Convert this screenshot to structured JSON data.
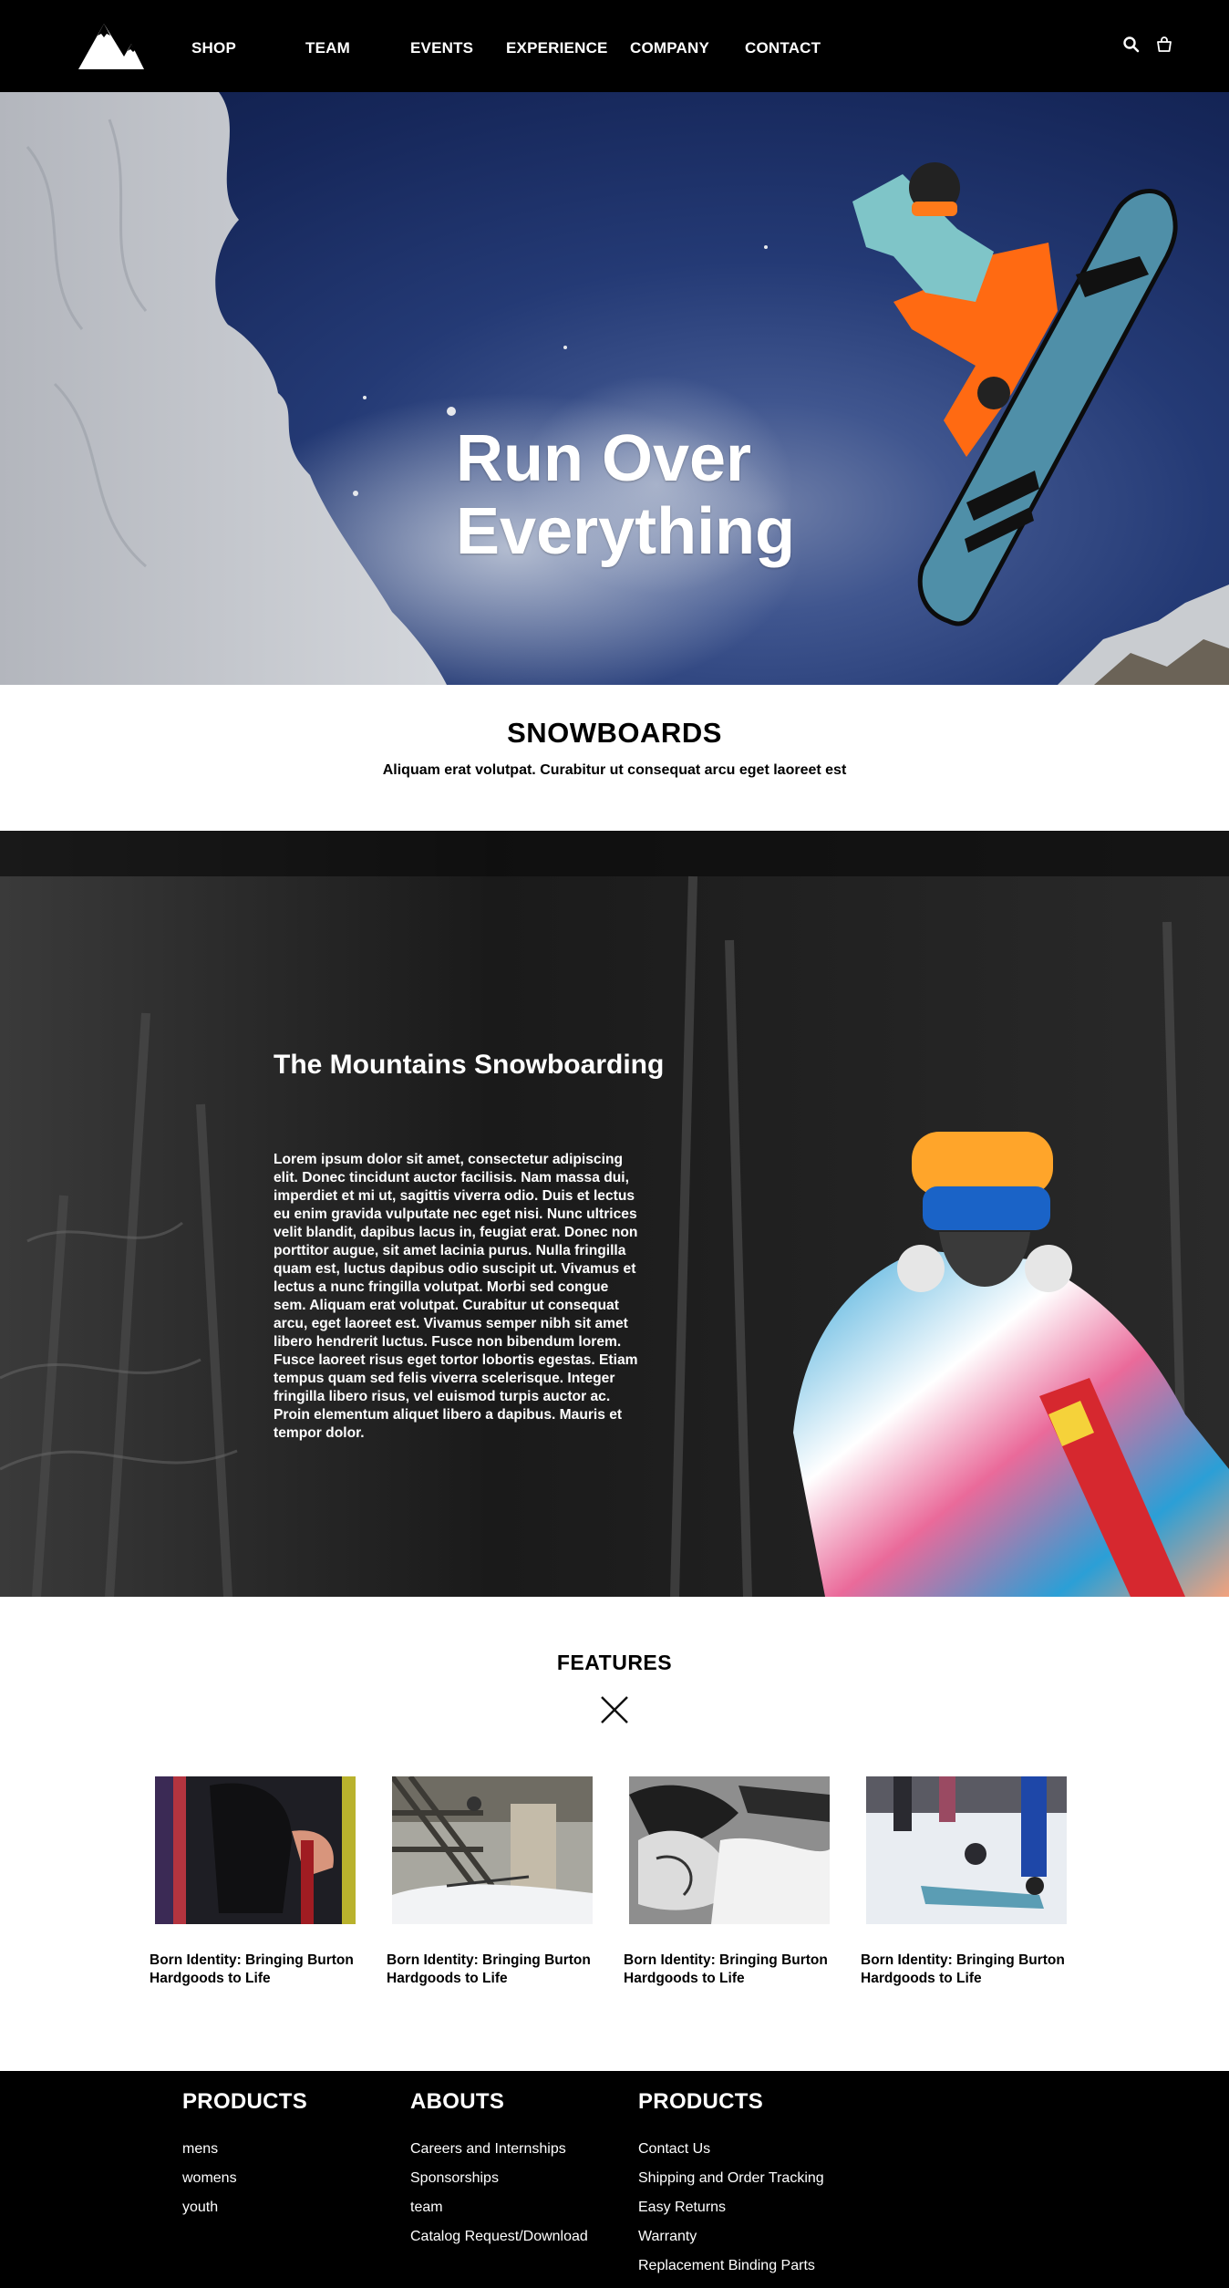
{
  "nav": {
    "items": [
      "SHOP",
      "TEAM",
      "EVENTS",
      "EXPERIENCE",
      "COMPANY",
      "CONTACT"
    ],
    "icons": [
      "mountain-logo",
      "search-icon",
      "cart-icon"
    ]
  },
  "hero": {
    "title_line1": "Run Over",
    "title_line2": "Everything"
  },
  "snowboards": {
    "title": "SNOWBOARDS",
    "subtitle": "Aliquam erat volutpat. Curabitur ut consequat arcu eget laoreet est"
  },
  "mountains": {
    "title": "The Mountains Snowboarding",
    "body": "Lorem ipsum dolor sit amet, consectetur adipiscing elit. Donec tincidunt auctor facilisis. Nam massa dui, imperdiet et mi ut, sagittis viverra odio. Duis et lectus eu enim gravida vulputate nec eget nisi. Nunc ultrices velit blandit, dapibus lacus in, feugiat erat. Donec non porttitor augue, sit amet lacinia purus. Nulla fringilla quam est, luctus dapibus odio suscipit ut. Vivamus et lectus a nunc fringilla volutpat. Morbi sed congue sem. Aliquam erat volutpat. Curabitur ut consequat arcu, eget laoreet est. Vivamus semper nibh sit amet libero hendrerit luctus. Fusce non bibendum lorem. Fusce laoreet risus eget tortor lobortis egestas. Etiam tempus quam sed felis viverra scelerisque. Integer fringilla libero risus, vel euismod turpis auctor ac. Proin elementum aliquet libero a dapibus. Mauris et tempor dolor."
  },
  "features": {
    "title": "FEATURES",
    "cards": [
      {
        "title": "Born Identity: Bringing Burton Hardgoods to Life"
      },
      {
        "title": "Born Identity: Bringing Burton Hardgoods to Life"
      },
      {
        "title": "Born Identity: Bringing Burton Hardgoods to Life"
      },
      {
        "title": "Born Identity: Bringing Burton Hardgoods to Life"
      }
    ]
  },
  "footer": {
    "col1": {
      "heading": "PRODUCTS",
      "links": [
        "mens",
        "womens",
        "youth"
      ]
    },
    "col2": {
      "heading": "ABOUTS",
      "links": [
        "Careers and Internships",
        "Sponsorships",
        "team",
        "Catalog Request/Download"
      ]
    },
    "col3": {
      "heading": "PRODUCTS",
      "links": [
        "Contact Us",
        "Shipping and Order Tracking",
        "Easy Returns",
        "Warranty",
        "Replacement Binding Parts"
      ]
    }
  },
  "colors": {
    "nav_bg": "#000000",
    "hero_sky": "#1c2f66",
    "footer_bg": "#000000",
    "text_dark": "#000000"
  }
}
